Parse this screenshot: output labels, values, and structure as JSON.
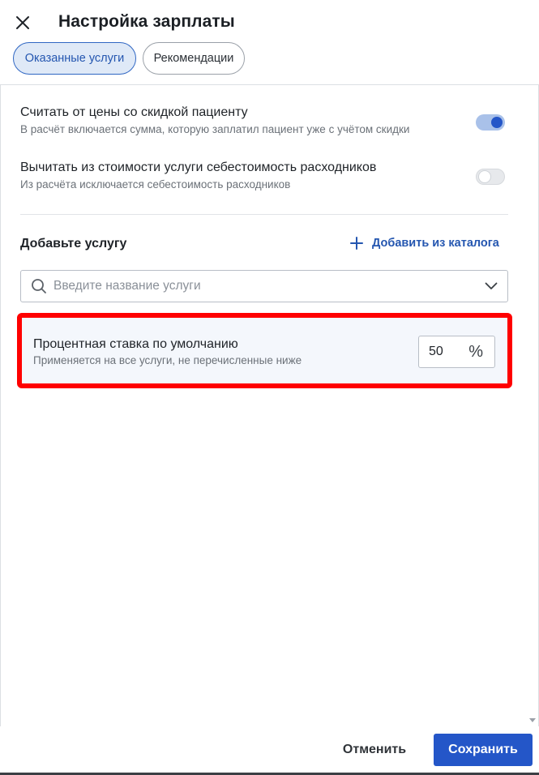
{
  "header": {
    "title": "Настройка зарплаты",
    "close_icon": "close-icon"
  },
  "tabs": [
    {
      "label": "Оказанные услуги",
      "active": true
    },
    {
      "label": "Рекомендации",
      "active": false
    }
  ],
  "settings": [
    {
      "title": "Считать от цены со скидкой пациенту",
      "description": "В расчёт включается сумма, которую заплатил пациент уже с учётом скидки",
      "enabled": true
    },
    {
      "title": "Вычитать из стоимости услуги себестоимость расходников",
      "description": "Из расчёта исключается себестоимость расходников",
      "enabled": false
    }
  ],
  "add_service": {
    "title": "Добавьте услугу",
    "catalog_link": "Добавить из каталога",
    "search_placeholder": "Введите название услуги"
  },
  "default_rate": {
    "title": "Процентная ставка по умолчанию",
    "description": "Применяется на все услуги, не перечисленные ниже",
    "value": "50",
    "unit": "%"
  },
  "footer": {
    "cancel_label": "Отменить",
    "save_label": "Сохранить"
  },
  "colors": {
    "accent": "#2456c8",
    "highlight": "#ff0000"
  }
}
